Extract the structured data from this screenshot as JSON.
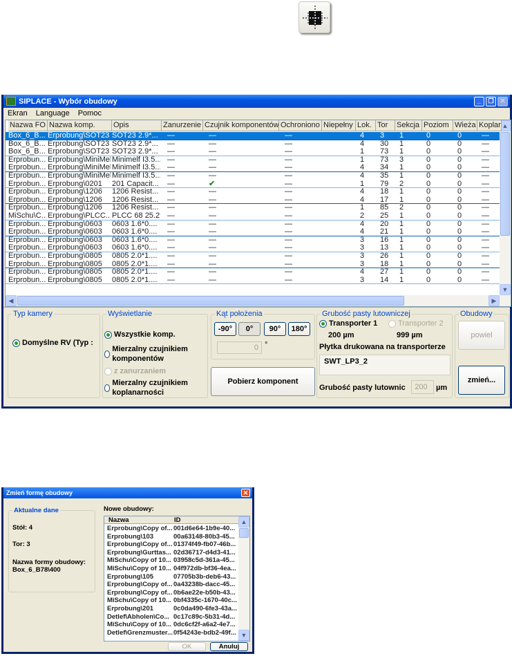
{
  "toolbar": {
    "icon": "component-center-icon"
  },
  "window": {
    "title": "SIPLACE - Wybór obudowy",
    "menu": [
      "Ekran",
      "Language",
      "Pomoc"
    ]
  },
  "grid": {
    "columns": [
      "Nazwa FO",
      "Nazwa komp.",
      "Opis",
      "Zanurzenie",
      "Czujnik komponentów",
      "Ochroniono",
      "Niepełny",
      "Lok.",
      "Tor",
      "Sekcja",
      "Poziom",
      "Wieża",
      "Koplan"
    ],
    "rows": [
      [
        "Box_6_B...",
        "Erprobung\\SOT23",
        "SOT23  2.9*...",
        "—",
        "—",
        "—",
        "",
        "4",
        "3",
        "1",
        "0",
        "0",
        "—"
      ],
      [
        "Box_6_B...",
        "Erprobung\\SOT23",
        "SOT23  2.9*...",
        "—",
        "—",
        "—",
        "",
        "4",
        "30",
        "1",
        "0",
        "0",
        "—"
      ],
      [
        "Box_6_B...",
        "Erprobung\\SOT23",
        "SOT23  2.9*...",
        "—",
        "—",
        "—",
        "",
        "1",
        "73",
        "1",
        "0",
        "0",
        "—"
      ],
      [
        "Erprobun...",
        "Erprobung\\MiniMelf",
        "Minimelf  I3.5...",
        "—",
        "—",
        "—",
        "",
        "1",
        "73",
        "3",
        "0",
        "0",
        "—"
      ],
      [
        "Erprobun...",
        "Erprobung\\MiniMelf",
        "Minimelf  I3.5...",
        "—",
        "—",
        "—",
        "",
        "4",
        "34",
        "1",
        "0",
        "0",
        "—"
      ],
      [
        "Erprobun...",
        "Erprobung\\MiniMelf",
        "Minimelf  I3.5...",
        "—",
        "—",
        "—",
        "",
        "4",
        "35",
        "1",
        "0",
        "0",
        "—"
      ],
      [
        "Erprobun...",
        "Erprobung\\0201",
        "201 Capacit...",
        "—",
        "✔",
        "—",
        "",
        "1",
        "79",
        "2",
        "0",
        "0",
        "—"
      ],
      [
        "Erprobun...",
        "Erprobung\\1206",
        "1206 Resist...",
        "—",
        "—",
        "—",
        "",
        "4",
        "18",
        "1",
        "0",
        "0",
        "—"
      ],
      [
        "Erprobun...",
        "Erprobung\\1206",
        "1206 Resist...",
        "—",
        "—",
        "—",
        "",
        "4",
        "17",
        "1",
        "0",
        "0",
        "—"
      ],
      [
        "Erprobun...",
        "Erprobung\\1206",
        "1206 Resist...",
        "—",
        "—",
        "—",
        "",
        "1",
        "85",
        "2",
        "0",
        "0",
        "—"
      ],
      [
        "MiSchu\\C...",
        "Erprobung\\PLCC...",
        "PLCC 68 25.2*",
        "—",
        "—",
        "—",
        "",
        "2",
        "25",
        "1",
        "0",
        "0",
        "—"
      ],
      [
        "Erprobun...",
        "Erprobung\\0603",
        "0603  1.6*0....",
        "—",
        "—",
        "—",
        "",
        "4",
        "20",
        "1",
        "0",
        "0",
        "—"
      ],
      [
        "Erprobun...",
        "Erprobung\\0603",
        "0603  1.6*0....",
        "—",
        "—",
        "—",
        "",
        "4",
        "21",
        "1",
        "0",
        "0",
        "—"
      ],
      [
        "Erprobun...",
        "Erprobung\\0603",
        "0603  1.6*0....",
        "—",
        "—",
        "—",
        "",
        "3",
        "16",
        "1",
        "0",
        "0",
        "—"
      ],
      [
        "Erprobun...",
        "Erprobung\\0603",
        "0603  1.6*0....",
        "—",
        "—",
        "—",
        "",
        "3",
        "13",
        "1",
        "0",
        "0",
        "—"
      ],
      [
        "Erprobun...",
        "Erprobung\\0805",
        "0805  2.0*1....",
        "—",
        "—",
        "—",
        "",
        "3",
        "26",
        "1",
        "0",
        "0",
        "—"
      ],
      [
        "Erprobun...",
        "Erprobung\\0805",
        "0805  2.0*1....",
        "—",
        "—",
        "—",
        "",
        "3",
        "18",
        "1",
        "0",
        "0",
        "—"
      ],
      [
        "Erprobun...",
        "Erprobung\\0805",
        "0805  2.0*1....",
        "—",
        "—",
        "—",
        "",
        "4",
        "27",
        "1",
        "0",
        "0",
        "—"
      ],
      [
        "Erprobun...",
        "Erprobung\\0805",
        "0805  2.0*1....",
        "—",
        "—",
        "—",
        "",
        "3",
        "14",
        "1",
        "0",
        "0",
        "—"
      ]
    ]
  },
  "camera": {
    "legend": "Typ kamery",
    "option": "Domyślne RV (Typ :"
  },
  "display": {
    "legend": "Wyświetlanie",
    "opt1": "Wszystkie komp.",
    "opt2": "Mierzalny czujnikiem komponentów",
    "opt3": "z zanurzaniem",
    "opt4": "Mierzalny czujnikiem koplanarności"
  },
  "angle": {
    "legend": "Kąt położenia",
    "buttons": [
      "-90°",
      "0°",
      "90°",
      "180°"
    ],
    "value": "0",
    "unit": "°",
    "fetch": "Pobierz komponent"
  },
  "paste": {
    "legend": "Grubość pasty lutowniczej",
    "t1": "Transporter 1",
    "t2": "Transporter 2",
    "v1": "200  µm",
    "v2": "999  µm",
    "pcb_label": "Płytka drukowana na transporterze",
    "pcb": "SWT_LP3_2",
    "thick_label": "Grubość pasty lutownic",
    "thick": "200",
    "unit": "µm"
  },
  "housings": {
    "legend": "Obudowy",
    "copy": "powiel",
    "change": "zmień..."
  },
  "dialog": {
    "title": "Zmień formę obudowy",
    "current_legend": "Aktualne dane",
    "table": "Stół: 4",
    "track": "Tor: 3",
    "name_label": "Nazwa formy obudowy:",
    "name": "Box_6_B78\\400",
    "new_label": "Nowe obudowy:",
    "columns": [
      "Nazwa",
      "ID"
    ],
    "rows": [
      [
        "Erprobung\\Copy of...",
        "001d6e64-1b9e-40..."
      ],
      [
        "Erprobung\\103",
        "00a63148-80b3-45..."
      ],
      [
        "Erprobung\\Copy of...",
        "01374f49-fb07-46b..."
      ],
      [
        "Erprobung\\Gurttas...",
        "02d36717-d4d3-41..."
      ],
      [
        "MiSchu\\Copy of 10...",
        "03958c5d-361a-45..."
      ],
      [
        "MiSchu\\Copy of 10...",
        "04f972db-bf36-4ea..."
      ],
      [
        "Erprobung\\105",
        "07705b3b-deb6-43..."
      ],
      [
        "Erprobung\\Copy of...",
        "0a43238b-dacc-45..."
      ],
      [
        "Erprobung\\Copy of...",
        "0b6ae22e-b50b-43..."
      ],
      [
        "MiSchu\\Copy of 10...",
        "0bf4335c-1670-40c..."
      ],
      [
        "Erprobung\\201",
        "0c0da490-6fe3-43a..."
      ],
      [
        "Detlef\\Abholen\\Co...",
        "0c17c89c-5b31-4d..."
      ],
      [
        "MiSchu\\Copy of 10...",
        "0dc6cf2f-a6a2-4e7..."
      ],
      [
        "Detlef\\Grenzmuster...",
        "0f54243e-bdb2-49f..."
      ]
    ],
    "ok": "OK",
    "cancel": "Anuluj"
  }
}
